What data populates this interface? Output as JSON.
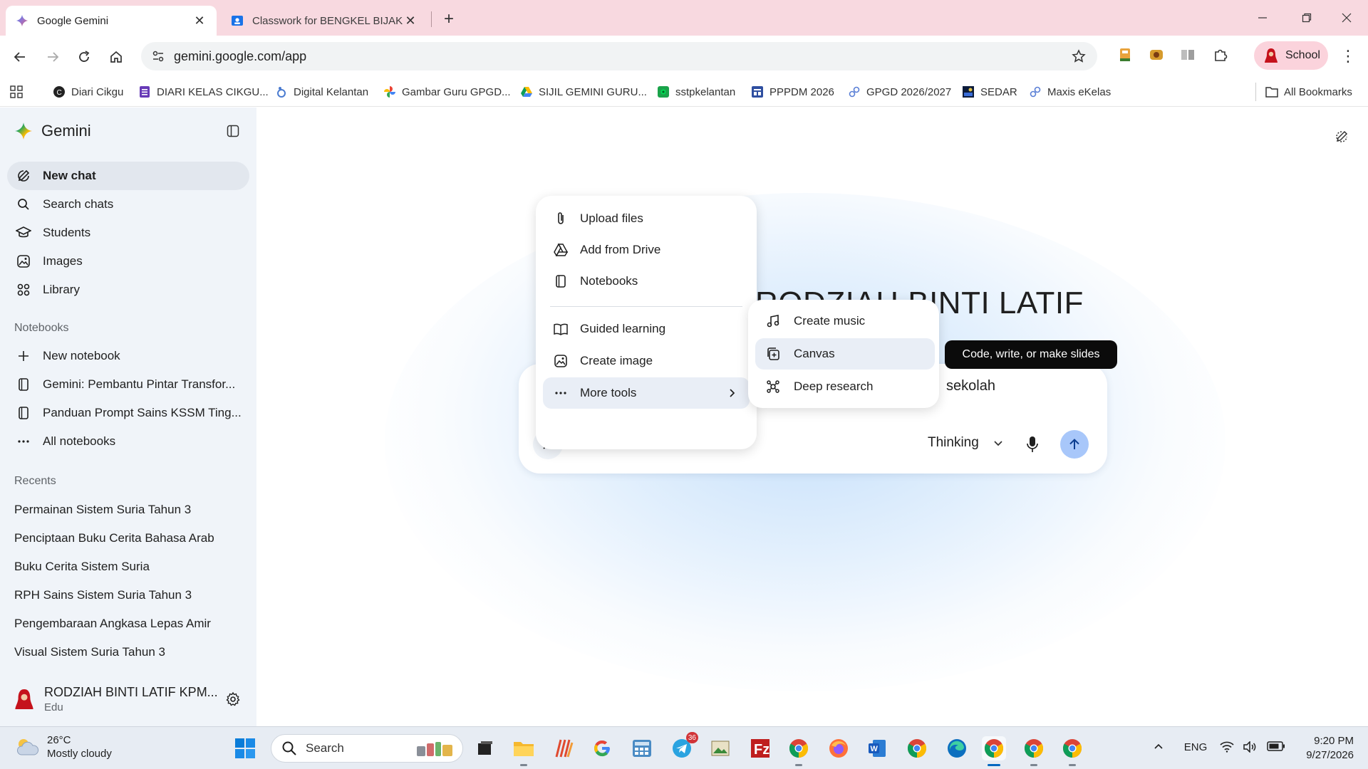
{
  "browser": {
    "tabs": [
      {
        "title": "Google Gemini",
        "active": true
      },
      {
        "title": "Classwork for BENGKEL BIJAK D",
        "active": false
      }
    ],
    "url": "gemini.google.com/app",
    "profile_label": "School",
    "bookmarks": [
      {
        "label": "Diari Cikgu",
        "icon": "diari-icon"
      },
      {
        "label": "DIARI KELAS CIKGU...",
        "icon": "forms-icon"
      },
      {
        "label": "Digital Kelantan",
        "icon": "digital-icon"
      },
      {
        "label": "Gambar Guru GPGD...",
        "icon": "photos-icon"
      },
      {
        "label": "SIJIL GEMINI GURU...",
        "icon": "drive-icon"
      },
      {
        "label": "sstpkelantan",
        "icon": "sstp-icon"
      },
      {
        "label": "PPPDM 2026",
        "icon": "pppdm-icon"
      },
      {
        "label": "GPGD 2026/2027",
        "icon": "link-icon"
      },
      {
        "label": "SEDAR",
        "icon": "sedar-icon"
      },
      {
        "label": "Maxis eKelas",
        "icon": "link-icon"
      }
    ],
    "all_bookmarks": "All Bookmarks"
  },
  "sidebar": {
    "brand": "Gemini",
    "nav": [
      {
        "label": "New chat",
        "icon": "edit-icon"
      },
      {
        "label": "Search chats",
        "icon": "search-icon"
      },
      {
        "label": "Students",
        "icon": "graduation-cap-icon"
      },
      {
        "label": "Images",
        "icon": "images-icon"
      },
      {
        "label": "Library",
        "icon": "library-icon"
      }
    ],
    "notebooks_title": "Notebooks",
    "notebooks": [
      {
        "label": "New notebook",
        "icon": "plus-icon"
      },
      {
        "label": "Gemini: Pembantu Pintar Transfor...",
        "icon": "notebook-icon"
      },
      {
        "label": "Panduan Prompt Sains KSSM Ting...",
        "icon": "notebook-icon"
      },
      {
        "label": "All notebooks",
        "icon": "more-horizontal-icon"
      }
    ],
    "recents_title": "Recents",
    "recents": [
      "Permainan Sistem Suria Tahun 3",
      "Penciptaan Buku Cerita Bahasa Arab",
      "Buku Cerita Sistem Suria",
      "RPH Sains Sistem Suria Tahun 3",
      "Pengembaraan Angkasa Lepas Amir",
      "Visual Sistem Suria Tahun 3"
    ],
    "account": {
      "name": "RODZIAH BINTI LATIF KPM...",
      "type": "Edu"
    }
  },
  "main": {
    "greeting_partial": "RODZIAH BINTI LATIF",
    "composer_text": "sekolah",
    "mode": "Thinking",
    "tools_menu": [
      {
        "label": "Upload files",
        "icon": "paperclip-icon"
      },
      {
        "label": "Add from Drive",
        "icon": "drive-icon"
      },
      {
        "label": "Notebooks",
        "icon": "notebook-icon"
      },
      {
        "label": "Guided learning",
        "icon": "guided-learning-icon"
      },
      {
        "label": "Create image",
        "icon": "create-image-icon"
      },
      {
        "label": "More tools",
        "icon": "more-horizontal-icon"
      }
    ],
    "more_tools_menu": [
      {
        "label": "Create music",
        "icon": "music-note-icon"
      },
      {
        "label": "Canvas",
        "icon": "canvas-icon"
      },
      {
        "label": "Deep research",
        "icon": "deep-research-icon"
      }
    ],
    "tooltip": "Code, write, or make slides"
  },
  "taskbar": {
    "weather": {
      "temp": "26°C",
      "desc": "Mostly cloudy"
    },
    "search_placeholder": "Search",
    "telegram_badge": "36",
    "lang": "ENG",
    "time": "9:20 PM",
    "date": "9/27/2026"
  },
  "colors": {
    "tabbar": "#f8d9e0",
    "sidebar": "#f0f4f9",
    "send_button": "#a8c7fa",
    "tooltip": "#0b0b0b",
    "accent_blue": "#0b57d0"
  }
}
